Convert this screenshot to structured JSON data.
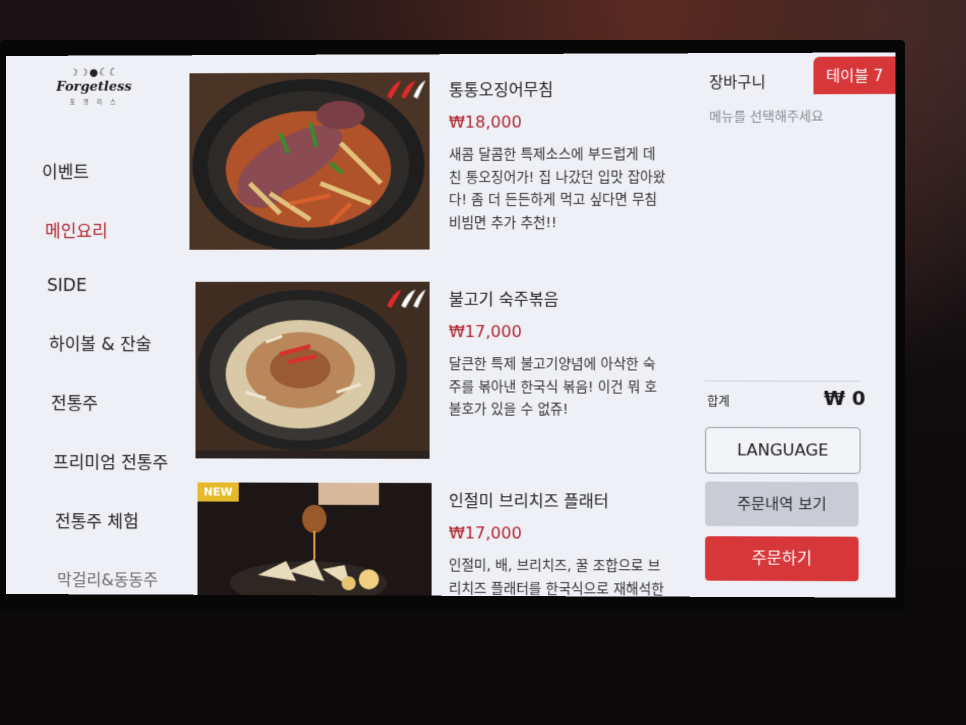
{
  "brand": {
    "name": "Forgetless",
    "sub": "포 겟 리 스"
  },
  "sidebar": {
    "items": [
      {
        "label": "이벤트"
      },
      {
        "label": "메인요리",
        "active": true
      },
      {
        "label": "SIDE"
      },
      {
        "label": "하이볼 & 잔술"
      },
      {
        "label": "전통주"
      },
      {
        "label": "프리미엄 전통주"
      },
      {
        "label": "전통주 체험"
      },
      {
        "label": "막걸리&동동주"
      }
    ]
  },
  "menu": {
    "items": [
      {
        "name": "통통오징어무침",
        "price": "₩18,000",
        "description": "새콤 달콤한 특제소스에 부드럽게 데친 통오징어가! 집 나갔던 입맛 잡아왔다! 좀 더 든든하게 먹고 싶다면 무침 비빔면 추가 추천!!",
        "spicy_level": 2
      },
      {
        "name": "불고기 숙주볶음",
        "price": "₩17,000",
        "description": "달큰한 특제 불고기양념에 아삭한 숙주를 볶아낸 한국식 볶음! 이건 뭐 호불호가 있을 수 없쥬!",
        "spicy_level": 2
      },
      {
        "name": "인절미 브리치즈 플래터",
        "price": "₩17,000",
        "description": "인절미, 배, 브리치즈, 꿀 조합으로 브리치즈 플래터를 한국식으로 재해석한 안주!",
        "badge": "NEW"
      }
    ]
  },
  "cart": {
    "title": "장바구니",
    "empty_message": "메뉴를 선택해주세요",
    "table_label": "테이블 7",
    "total_label": "합계",
    "total_value": "₩ 0",
    "language_button": "LANGUAGE",
    "history_button": "주문내역 보기",
    "order_button": "주문하기"
  },
  "colors": {
    "accent": "#d8373a",
    "price": "#b0252f",
    "screen_bg": "#eef0f6"
  }
}
